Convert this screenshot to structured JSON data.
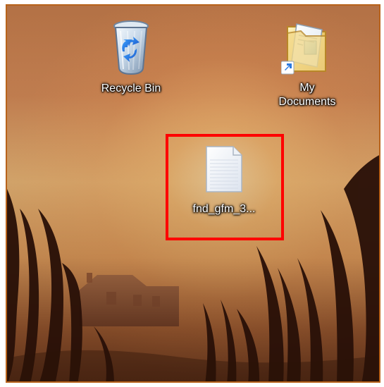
{
  "desktop": {
    "icons": [
      {
        "label": "Recycle Bin",
        "icon": "recycle-bin-icon"
      },
      {
        "label": "My\nDocuments",
        "icon": "folder-documents-icon"
      },
      {
        "label": "fnd_gfm_3...",
        "icon": "text-file-icon"
      }
    ]
  },
  "colors": {
    "selection_box": "#ff0000",
    "frame": "#b8631b",
    "sky_top": "#b37145",
    "sky_glow": "#ebbb7a"
  }
}
